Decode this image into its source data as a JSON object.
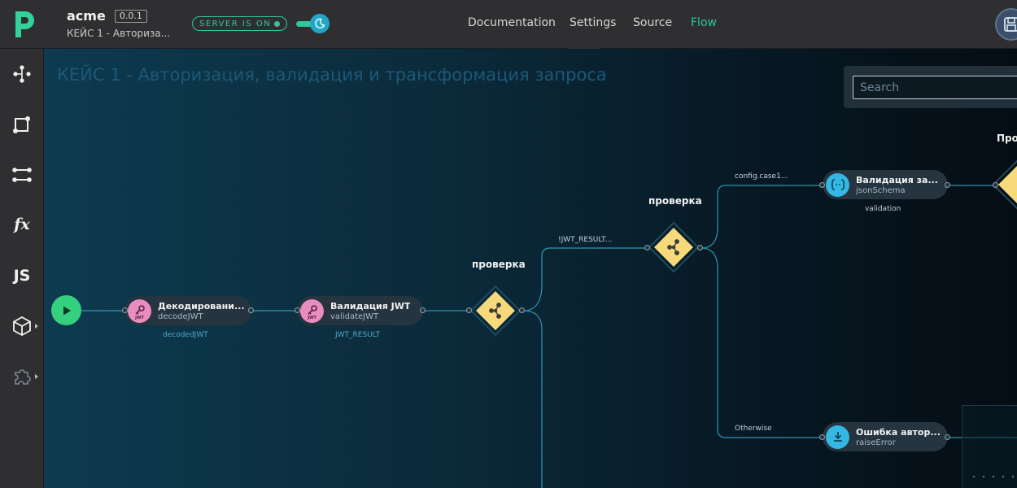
{
  "header": {
    "project_name": "acme",
    "version": "0.0.1",
    "project_subtitle": "КЕЙС 1 - Авториза...",
    "server_status": "SERVER IS ON",
    "nav": [
      "Documentation",
      "Settings",
      "Source",
      "Flow"
    ],
    "active_nav": "Flow"
  },
  "sidebar": {
    "items": [
      "flow-icon",
      "node-square-icon",
      "connection-icon",
      "fx",
      "JS",
      "cube-icon",
      "puzzle-icon"
    ]
  },
  "canvas": {
    "title": "КЕЙС 1 - Авторизация, валидация и трансформация запроса",
    "search_placeholder": "Search"
  },
  "flow": {
    "nodes": [
      {
        "title": "Декодировани...",
        "sub": "decodeJWT",
        "output": "decodedJWT",
        "icon_tag": "JWT"
      },
      {
        "title": "Валидация JWT",
        "sub": "validateJWT",
        "output": "JWT_RESULT",
        "icon_tag": "JWT"
      },
      {
        "title": "Валидация за...",
        "sub": "jsonSchema",
        "output": "validation"
      },
      {
        "title": "Ошибка автор...",
        "sub": "raiseError"
      }
    ],
    "switches": [
      {
        "label": "проверка"
      },
      {
        "label": "проверка"
      },
      {
        "label": "Про"
      }
    ],
    "edge_labels": [
      "!JWT_RESULT...",
      "config.case1...",
      "Otherwise"
    ]
  },
  "colors": {
    "accent": "#2fc69a",
    "switch": "#f6d97a",
    "start": "#35d07f",
    "node_pink": "#e98cbf",
    "node_blue": "#35b7e3"
  }
}
